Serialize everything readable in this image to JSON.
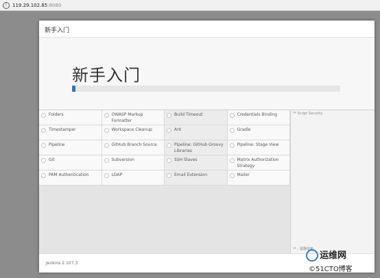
{
  "browser": {
    "url_host": "119.29.102.85",
    "url_port": ":8080",
    "info_icon_glyph": "i"
  },
  "panel": {
    "header_title": "新手入门",
    "hero_title": "新手入门",
    "progress_fraction": 0.012,
    "progress_color": "#3b71b0"
  },
  "plugins": [
    {
      "name": "Folders"
    },
    {
      "name": "OWASP Markup Formatter"
    },
    {
      "name": "Build Timeout"
    },
    {
      "name": "Credentials Binding"
    },
    {
      "name": "Timestamper"
    },
    {
      "name": "Workspace Cleanup"
    },
    {
      "name": "Ant"
    },
    {
      "name": "Gradle"
    },
    {
      "name": "Pipeline"
    },
    {
      "name": "GitHub Branch Source"
    },
    {
      "name": "Pipeline: GitHub Groovy Libraries"
    },
    {
      "name": "Pipeline: Stage View"
    },
    {
      "name": "Git"
    },
    {
      "name": "Subversion"
    },
    {
      "name": "SSH Slaves"
    },
    {
      "name": "Matrix Authorization Strategy"
    },
    {
      "name": "PAM Authentication"
    },
    {
      "name": "LDAP"
    },
    {
      "name": "Email Extension"
    },
    {
      "name": "Mailer"
    }
  ],
  "log": {
    "top_line": "** Script Security",
    "bottom_line": "** - 需要依赖"
  },
  "footer": {
    "version": "Jenkins 2.107.3"
  },
  "watermark": {
    "line1": "运维网",
    "line2": "©51CTO博客"
  }
}
